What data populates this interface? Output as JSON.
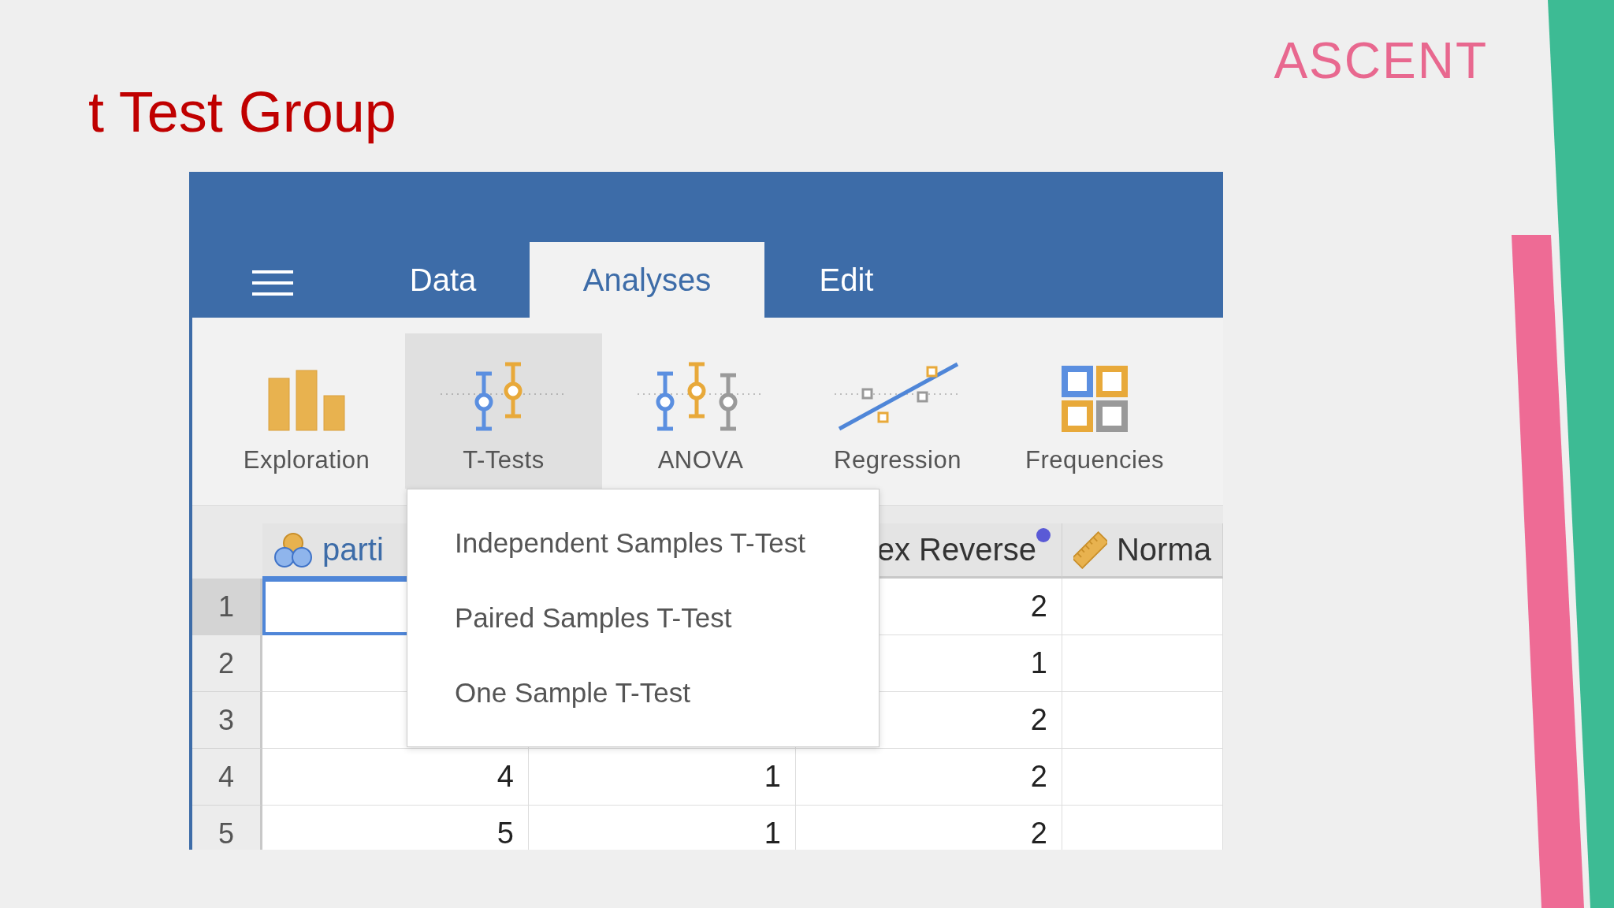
{
  "slide_title": "t Test Group",
  "logo": {
    "text": "ASCENT"
  },
  "app": {
    "tabs": [
      {
        "label": "Data",
        "selected": false
      },
      {
        "label": "Analyses",
        "selected": true
      },
      {
        "label": "Edit",
        "selected": false
      }
    ],
    "ribbon": [
      {
        "kind": "exploration",
        "label": "Exploration",
        "selected": false
      },
      {
        "kind": "ttests",
        "label": "T-Tests",
        "selected": true
      },
      {
        "kind": "anova",
        "label": "ANOVA",
        "selected": false
      },
      {
        "kind": "regression",
        "label": "Regression",
        "selected": false
      },
      {
        "kind": "frequencies",
        "label": "Frequencies",
        "selected": false
      }
    ],
    "menu": [
      "Independent Samples T-Test",
      "Paired Samples T-Test",
      "One Sample T-Test"
    ],
    "columns": [
      {
        "name": "parti",
        "kind": "nominal",
        "dot": false
      },
      {
        "kind": "none"
      },
      {
        "name": "ex Reverse",
        "kind": "none",
        "dot": true
      },
      {
        "name": "Norma",
        "kind": "continuous",
        "dot": false
      }
    ],
    "rows": [
      {
        "number": "1",
        "selected": true,
        "cells": [
          null,
          null,
          "2",
          null
        ]
      },
      {
        "number": "2",
        "selected": false,
        "cells": [
          null,
          null,
          "1",
          null
        ]
      },
      {
        "number": "3",
        "selected": false,
        "cells": [
          null,
          null,
          "2",
          null
        ]
      },
      {
        "number": "4",
        "selected": false,
        "cells": [
          "4",
          "1",
          "2",
          null
        ]
      },
      {
        "number": "5",
        "selected": false,
        "cells": [
          "5",
          "1",
          "2",
          null
        ]
      }
    ]
  }
}
